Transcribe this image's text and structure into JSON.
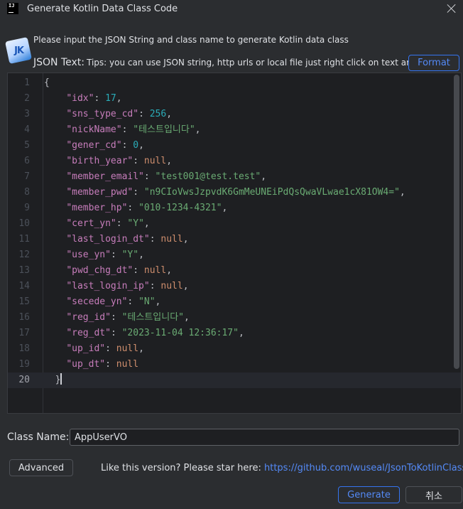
{
  "window": {
    "title": "Generate Kotlin Data Class Code",
    "logo_text": "IJ"
  },
  "header": {
    "plugin_icon_text": "JK",
    "description": "Please input the JSON String and class name to generate Kotlin data class",
    "json_label": "JSON Text:",
    "tips": "Tips: you can use JSON string, http urls or local file just right click on text area",
    "format_button": "Format"
  },
  "editor": {
    "current_line": 20,
    "lines": [
      [
        {
          "t": "p",
          "v": "{"
        }
      ],
      [
        {
          "t": "p",
          "v": "    "
        },
        {
          "t": "k",
          "v": "\"idx\""
        },
        {
          "t": "p",
          "v": ": "
        },
        {
          "t": "n",
          "v": "17"
        },
        {
          "t": "p",
          "v": ","
        }
      ],
      [
        {
          "t": "p",
          "v": "    "
        },
        {
          "t": "k",
          "v": "\"sns_type_cd\""
        },
        {
          "t": "p",
          "v": ": "
        },
        {
          "t": "n",
          "v": "256"
        },
        {
          "t": "p",
          "v": ","
        }
      ],
      [
        {
          "t": "p",
          "v": "    "
        },
        {
          "t": "k",
          "v": "\"nickName\""
        },
        {
          "t": "p",
          "v": ": "
        },
        {
          "t": "s",
          "v": "\"테스트입니다\""
        },
        {
          "t": "p",
          "v": ","
        }
      ],
      [
        {
          "t": "p",
          "v": "    "
        },
        {
          "t": "k",
          "v": "\"gener_cd\""
        },
        {
          "t": "p",
          "v": ": "
        },
        {
          "t": "n",
          "v": "0"
        },
        {
          "t": "p",
          "v": ","
        }
      ],
      [
        {
          "t": "p",
          "v": "    "
        },
        {
          "t": "k",
          "v": "\"birth_year\""
        },
        {
          "t": "p",
          "v": ": "
        },
        {
          "t": "kw",
          "v": "null"
        },
        {
          "t": "p",
          "v": ","
        }
      ],
      [
        {
          "t": "p",
          "v": "    "
        },
        {
          "t": "k",
          "v": "\"member_email\""
        },
        {
          "t": "p",
          "v": ": "
        },
        {
          "t": "s",
          "v": "\"test001@test.test\""
        },
        {
          "t": "p",
          "v": ","
        }
      ],
      [
        {
          "t": "p",
          "v": "    "
        },
        {
          "t": "k",
          "v": "\"member_pwd\""
        },
        {
          "t": "p",
          "v": ": "
        },
        {
          "t": "s",
          "v": "\"n9CIoVwsJzpvdK6GmMeUNEiPdQsQwaVLwae1cX81OW4=\""
        },
        {
          "t": "p",
          "v": ","
        }
      ],
      [
        {
          "t": "p",
          "v": "    "
        },
        {
          "t": "k",
          "v": "\"member_hp\""
        },
        {
          "t": "p",
          "v": ": "
        },
        {
          "t": "s",
          "v": "\"010-1234-4321\""
        },
        {
          "t": "p",
          "v": ","
        }
      ],
      [
        {
          "t": "p",
          "v": "    "
        },
        {
          "t": "k",
          "v": "\"cert_yn\""
        },
        {
          "t": "p",
          "v": ": "
        },
        {
          "t": "s",
          "v": "\"Y\""
        },
        {
          "t": "p",
          "v": ","
        }
      ],
      [
        {
          "t": "p",
          "v": "    "
        },
        {
          "t": "k",
          "v": "\"last_login_dt\""
        },
        {
          "t": "p",
          "v": ": "
        },
        {
          "t": "kw",
          "v": "null"
        },
        {
          "t": "p",
          "v": ","
        }
      ],
      [
        {
          "t": "p",
          "v": "    "
        },
        {
          "t": "k",
          "v": "\"use_yn\""
        },
        {
          "t": "p",
          "v": ": "
        },
        {
          "t": "s",
          "v": "\"Y\""
        },
        {
          "t": "p",
          "v": ","
        }
      ],
      [
        {
          "t": "p",
          "v": "    "
        },
        {
          "t": "k",
          "v": "\"pwd_chg_dt\""
        },
        {
          "t": "p",
          "v": ": "
        },
        {
          "t": "kw",
          "v": "null"
        },
        {
          "t": "p",
          "v": ","
        }
      ],
      [
        {
          "t": "p",
          "v": "    "
        },
        {
          "t": "k",
          "v": "\"last_login_ip\""
        },
        {
          "t": "p",
          "v": ": "
        },
        {
          "t": "kw",
          "v": "null"
        },
        {
          "t": "p",
          "v": ","
        }
      ],
      [
        {
          "t": "p",
          "v": "    "
        },
        {
          "t": "k",
          "v": "\"secede_yn\""
        },
        {
          "t": "p",
          "v": ": "
        },
        {
          "t": "s",
          "v": "\"N\""
        },
        {
          "t": "p",
          "v": ","
        }
      ],
      [
        {
          "t": "p",
          "v": "    "
        },
        {
          "t": "k",
          "v": "\"reg_id\""
        },
        {
          "t": "p",
          "v": ": "
        },
        {
          "t": "s",
          "v": "\"테스트입니다\""
        },
        {
          "t": "p",
          "v": ","
        }
      ],
      [
        {
          "t": "p",
          "v": "    "
        },
        {
          "t": "k",
          "v": "\"reg_dt\""
        },
        {
          "t": "p",
          "v": ": "
        },
        {
          "t": "s",
          "v": "\"2023-11-04 12:36:17\""
        },
        {
          "t": "p",
          "v": ","
        }
      ],
      [
        {
          "t": "p",
          "v": "    "
        },
        {
          "t": "k",
          "v": "\"up_id\""
        },
        {
          "t": "p",
          "v": ": "
        },
        {
          "t": "kw",
          "v": "null"
        },
        {
          "t": "p",
          "v": ","
        }
      ],
      [
        {
          "t": "p",
          "v": "    "
        },
        {
          "t": "k",
          "v": "\"up_dt\""
        },
        {
          "t": "p",
          "v": ": "
        },
        {
          "t": "kw",
          "v": "null"
        }
      ],
      [
        {
          "t": "p",
          "v": "  }"
        }
      ]
    ]
  },
  "form": {
    "class_name_label": "Class Name:",
    "class_name_value": "AppUserVO"
  },
  "footer": {
    "advanced_button": "Advanced",
    "like_text": "Like this version? Please star here:",
    "link_text": "https://github.com/wuseal/JsonToKotlinClass",
    "generate_button": "Generate",
    "cancel_button": "취소"
  },
  "colors": {
    "background": "#2b2d30",
    "editor_bg": "#1e1f22",
    "accent": "#3574f0",
    "json_key": "#c77dbb",
    "json_string": "#6aab73",
    "json_number": "#2aacb8",
    "json_null": "#cf8e6d"
  }
}
